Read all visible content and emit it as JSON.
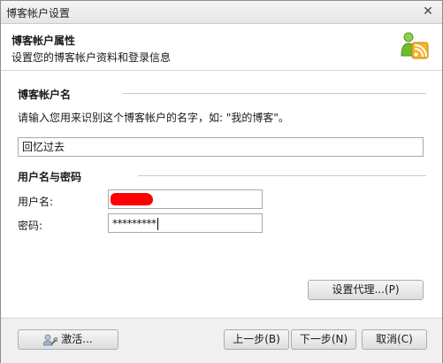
{
  "window": {
    "title": "博客帐户设置",
    "close_glyph": "✕"
  },
  "header": {
    "title": "博客帐户属性",
    "subtitle": "设置您的博客帐户资料和登录信息",
    "icon": "blog-account-icon"
  },
  "blog_name": {
    "section_title": "博客帐户名",
    "hint": "请输入您用来识别这个博客帐户的名字，如: \"我的博客\"。",
    "value": "回忆过去"
  },
  "credentials": {
    "section_title": "用户名与密码",
    "username_label": "用户名:",
    "password_label": "密码:",
    "password_value": "*********"
  },
  "buttons": {
    "proxy": "设置代理...(P)",
    "activate": "激活...",
    "back": "上一步(B)",
    "next": "下一步(N)",
    "cancel": "取消(C)"
  },
  "colors": {
    "accent_green": "#6cbf2a",
    "redaction": "#ff0000"
  }
}
